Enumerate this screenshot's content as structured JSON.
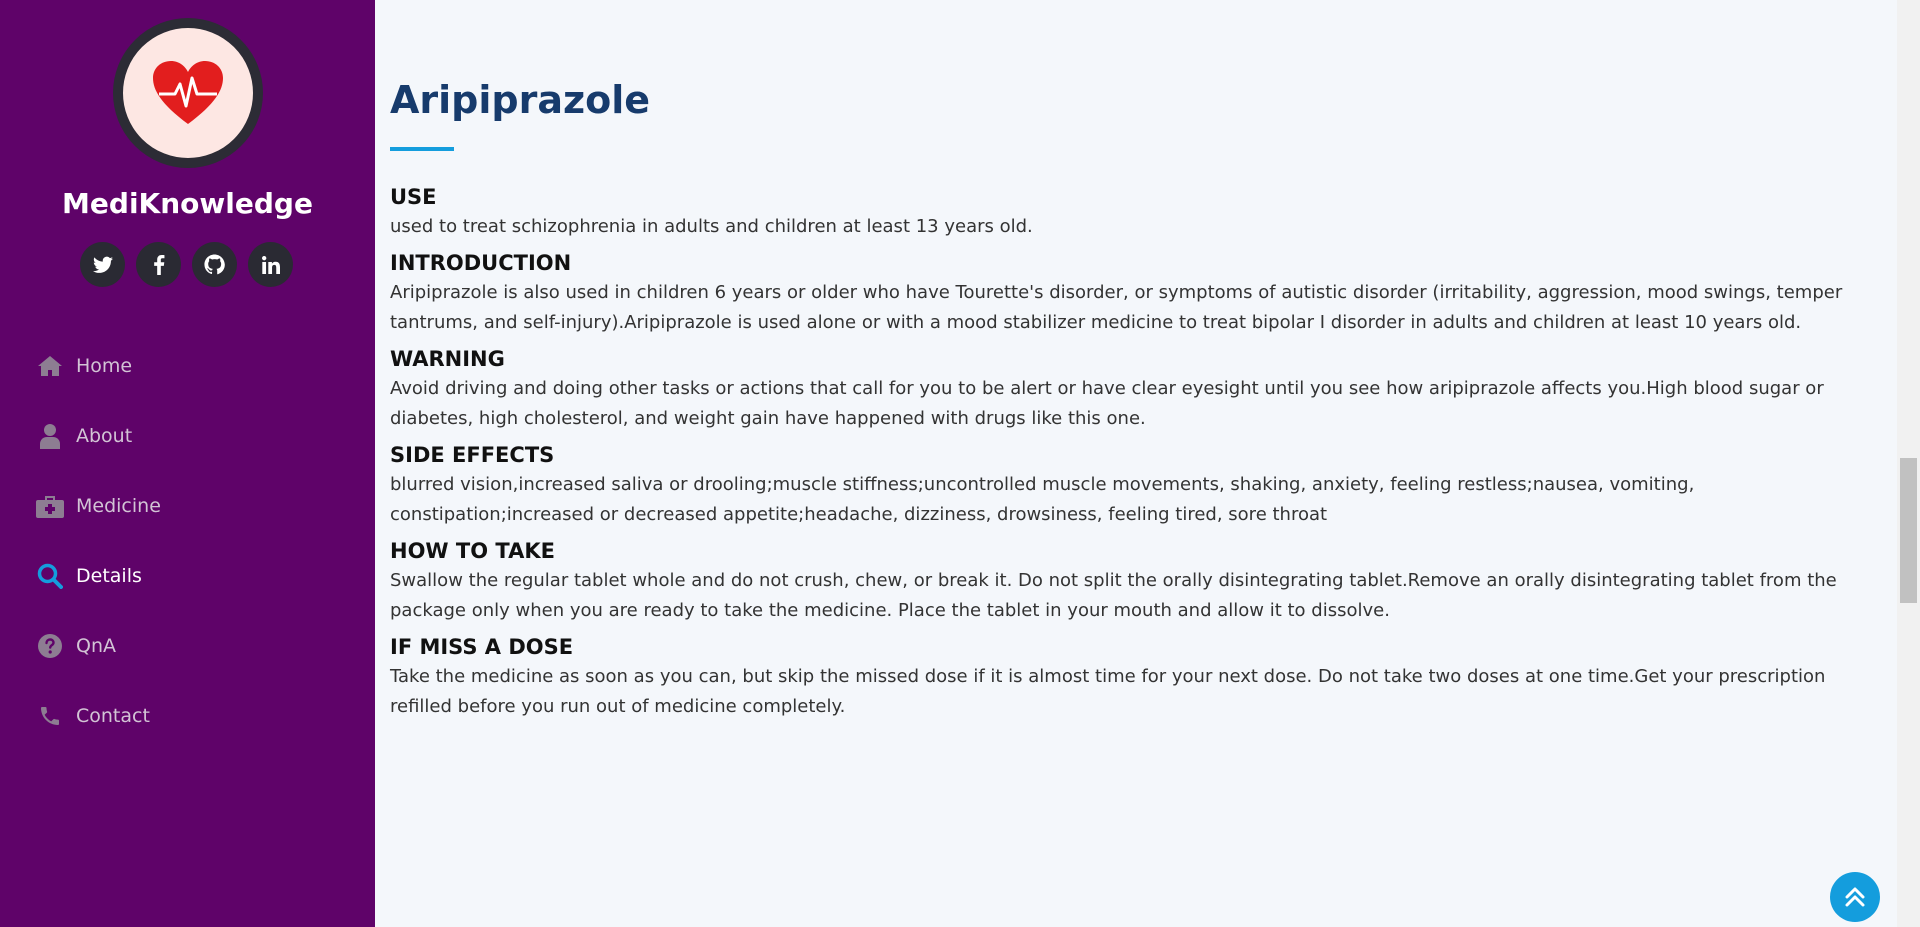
{
  "brand": {
    "name": "MediKnowledge",
    "logo_icon": "heart-pulse-icon",
    "logo_color": "#e21e1e"
  },
  "social": [
    {
      "name": "twitter",
      "icon": "twitter-icon"
    },
    {
      "name": "facebook",
      "icon": "facebook-icon"
    },
    {
      "name": "github",
      "icon": "github-icon"
    },
    {
      "name": "linkedin",
      "icon": "linkedin-icon"
    }
  ],
  "nav": [
    {
      "label": "Home",
      "icon": "home-icon"
    },
    {
      "label": "About",
      "icon": "user-icon"
    },
    {
      "label": "Medicine",
      "icon": "medkit-icon"
    },
    {
      "label": "Details",
      "icon": "search-icon",
      "active": true
    },
    {
      "label": "QnA",
      "icon": "question-circle-icon"
    },
    {
      "label": "Contact",
      "icon": "phone-icon"
    }
  ],
  "page": {
    "title": "Aripiprazole"
  },
  "sections": [
    {
      "heading": "USE",
      "text": "used to treat schizophrenia in adults and children at least 13 years old."
    },
    {
      "heading": "INTRODUCTION",
      "text": "Aripiprazole is also used in children 6 years or older who have Tourette's disorder, or symptoms of autistic disorder (irritability, aggression, mood swings, temper tantrums, and self-injury).Aripiprazole is used alone or with a mood stabilizer medicine to treat bipolar I disorder in adults and children at least 10 years old."
    },
    {
      "heading": "WARNING",
      "text": "Avoid driving and doing other tasks or actions that call for you to be alert or have clear eyesight until you see how aripiprazole affects you.High blood sugar or diabetes, high cholesterol, and weight gain have happened with drugs like this one."
    },
    {
      "heading": "SIDE EFFECTS",
      "text": "blurred vision,increased saliva or drooling;muscle stiffness;uncontrolled muscle movements, shaking, anxiety, feeling restless;nausea, vomiting, constipation;increased or decreased appetite;headache, dizziness, drowsiness, feeling tired, sore throat"
    },
    {
      "heading": "HOW TO TAKE",
      "text": "Swallow the regular tablet whole and do not crush, chew, or break it. Do not split the orally disintegrating tablet.Remove an orally disintegrating tablet from the package only when you are ready to take the medicine. Place the tablet in your mouth and allow it to dissolve."
    },
    {
      "heading": "IF MISS A DOSE",
      "text": "Take the medicine as soon as you can, but skip the missed dose if it is almost time for your next dose. Do not take two doses at one time.Get your prescription refilled before you run out of medicine completely."
    }
  ],
  "colors": {
    "sidebar": "#5f0369",
    "accent": "#149ddd",
    "title": "#173b6c",
    "background": "#f4f7fb"
  }
}
